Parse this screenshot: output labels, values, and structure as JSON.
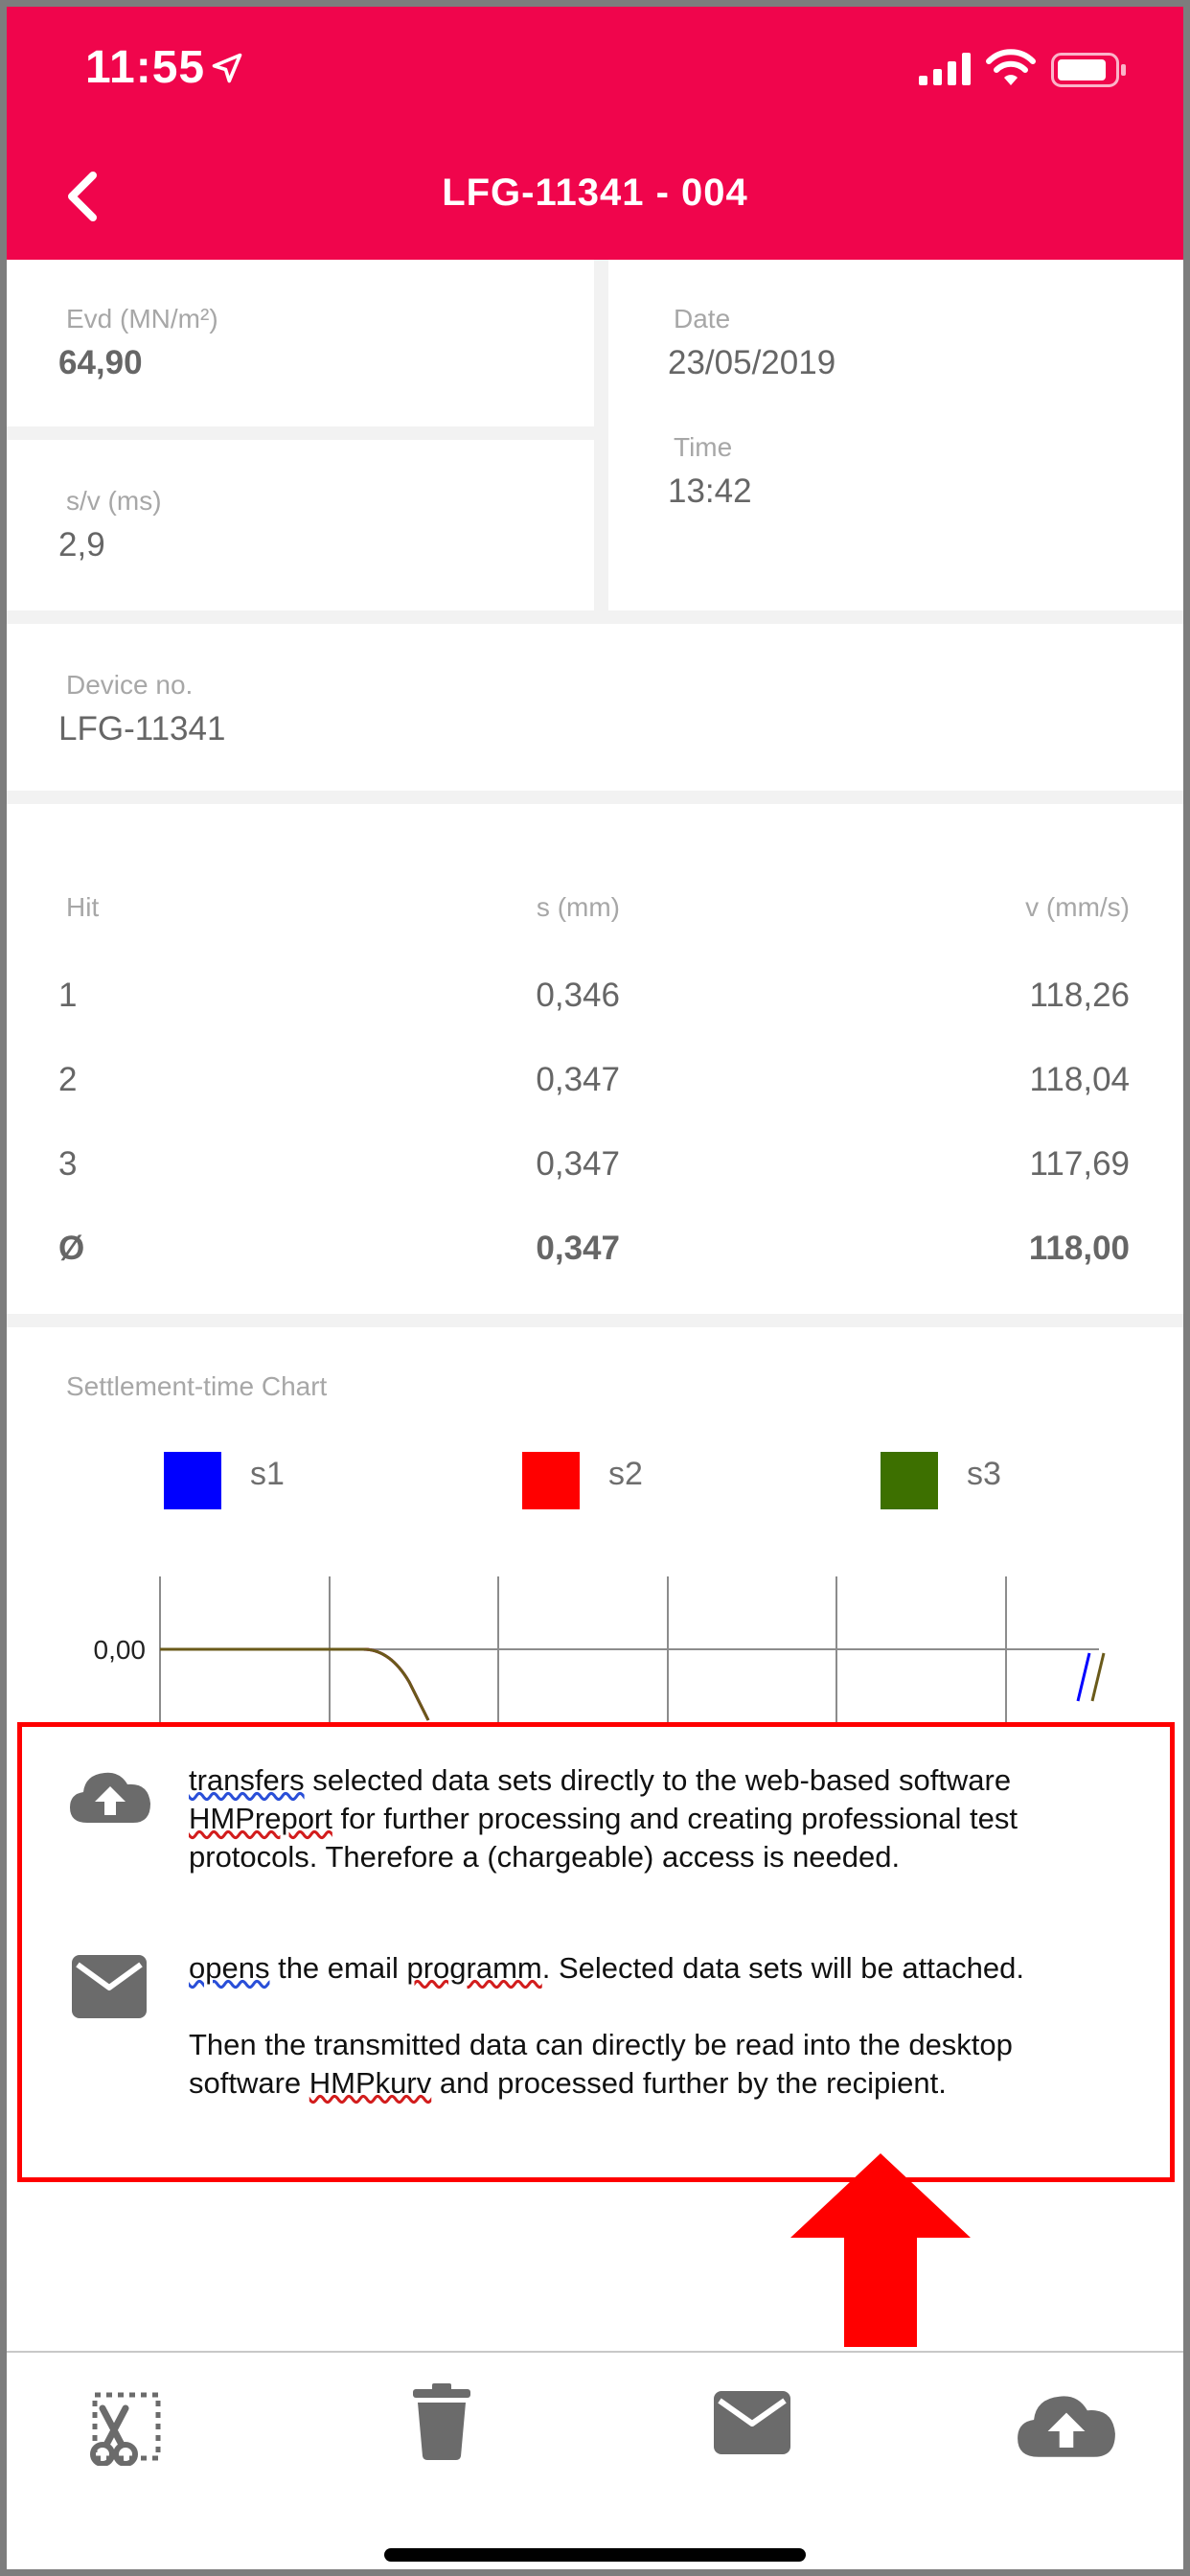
{
  "status": {
    "time": "11:55"
  },
  "nav": {
    "title": "LFG-11341 - 004"
  },
  "measure": {
    "evd_label": "Evd (MN/m²)",
    "evd_value": "64,90",
    "sv_label": "s/v (ms)",
    "sv_value": "2,9",
    "date_label": "Date",
    "date_value": "23/05/2019",
    "time_label": "Time",
    "time_value": "13:42"
  },
  "device": {
    "label": "Device no.",
    "value": "LFG-11341"
  },
  "table": {
    "headers": [
      "Hit",
      "s (mm)",
      "v (mm/s)"
    ],
    "rows": [
      [
        "1",
        "0,346",
        "118,26"
      ],
      [
        "2",
        "0,347",
        "118,04"
      ],
      [
        "3",
        "0,347",
        "117,69"
      ],
      [
        "Ø",
        "0,347",
        "118,00"
      ]
    ]
  },
  "chart_data": {
    "type": "line",
    "title": "Settlement-time Chart",
    "series": [
      {
        "name": "s1",
        "color": "#0000ff"
      },
      {
        "name": "s2",
        "color": "#ff0000"
      },
      {
        "name": "s3",
        "color": "#3d7000"
      }
    ],
    "y_tick_labels": [
      "0,00"
    ],
    "grid": true,
    "legend_position": "top"
  },
  "overlay": {
    "upload_underlined": "transfers",
    "upload_text_1": " selected data sets directly to the web-based software",
    "upload_link": "HMPreport",
    "upload_text_2": " for further processing and creating professional test",
    "upload_text_3": "protocols. Therefore a (chargeable) access is needed.",
    "mail_underlined": "opens",
    "mail_text_1": " the email ",
    "mail_underlined_2": "programm",
    "mail_text_2": ". Selected data sets will be attached.",
    "mail_text_3": "Then the transmitted data can directly be read into the desktop",
    "mail_text_4": "software ",
    "mail_link": "HMPkurv",
    "mail_text_5": " and processed further by the recipient."
  },
  "toolbar": {
    "icons": [
      "scissors-icon",
      "trash-icon",
      "mail-icon",
      "cloud-upload-icon"
    ]
  },
  "colors": {
    "accent": "#f0054c",
    "annotation": "#ff0000",
    "icon_gray": "#6b6b6b"
  }
}
